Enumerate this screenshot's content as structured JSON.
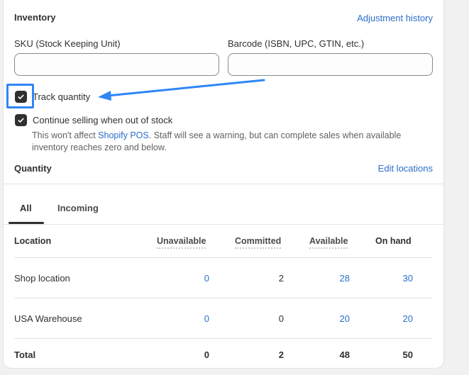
{
  "header": {
    "title": "Inventory",
    "adjustment_link": "Adjustment history"
  },
  "fields": {
    "sku_label": "SKU (Stock Keeping Unit)",
    "sku_value": "",
    "barcode_label": "Barcode (ISBN, UPC, GTIN, etc.)",
    "barcode_value": ""
  },
  "track_quantity": {
    "label": "Track quantity",
    "checked": true
  },
  "continue_selling": {
    "label": "Continue selling when out of stock",
    "checked": true,
    "help_prefix": "This won't affect ",
    "help_link": "Shopify POS",
    "help_suffix": ". Staff will see a warning, but can complete sales when available inventory reaches zero and below."
  },
  "quantity": {
    "title": "Quantity",
    "edit_link": "Edit locations"
  },
  "tabs": [
    {
      "label": "All",
      "active": true
    },
    {
      "label": "Incoming",
      "active": false
    }
  ],
  "table": {
    "headers": [
      "Location",
      "Unavailable",
      "Committed",
      "Available",
      "On hand"
    ],
    "rows": [
      {
        "location": "Shop location",
        "unavailable": "0",
        "committed": "2",
        "available": "28",
        "on_hand": "30"
      },
      {
        "location": "USA Warehouse",
        "unavailable": "0",
        "committed": "0",
        "available": "20",
        "on_hand": "20"
      }
    ],
    "total": {
      "label": "Total",
      "unavailable": "0",
      "committed": "2",
      "available": "48",
      "on_hand": "50"
    }
  },
  "colors": {
    "link": "#2c6ecb",
    "annotation": "#2f86f6",
    "checkbox": "#303030"
  }
}
